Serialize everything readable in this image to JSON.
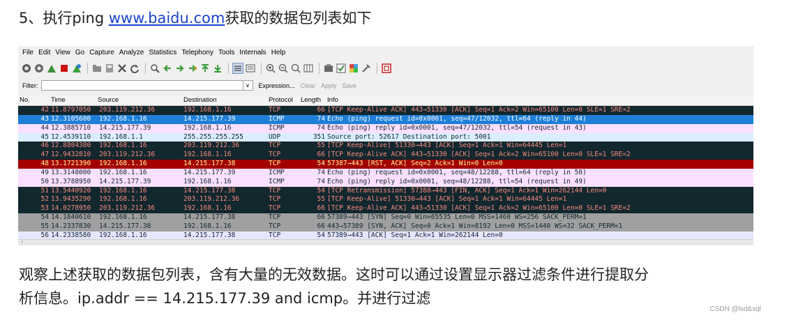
{
  "heading": {
    "prefix": "5、执行ping ",
    "link": "www.baidu.com",
    "suffix": "获取的数据包列表如下"
  },
  "menu": [
    "File",
    "Edit",
    "View",
    "Go",
    "Capture",
    "Analyze",
    "Statistics",
    "Telephony",
    "Tools",
    "Internals",
    "Help"
  ],
  "filter": {
    "label": "Filter:",
    "value": "",
    "expression": "Expression...",
    "clear": "Clear",
    "apply": "Apply",
    "save": "Save"
  },
  "columns": {
    "no": "No.",
    "time": "Time",
    "source": "Source",
    "destination": "Destination",
    "protocol": "Protocol",
    "length": "Length",
    "info": "Info"
  },
  "row_colors": {
    "dark": {
      "bg": "#12272e",
      "fg": "#f78b7e"
    },
    "selected": {
      "bg": "#1e7fd8",
      "fg": "#ffffff"
    },
    "icmp": {
      "bg": "#fce0ff",
      "fg": "#12272e"
    },
    "udp": {
      "bg": "#daeeff",
      "fg": "#12272e"
    },
    "rst": {
      "bg": "#a40000",
      "fg": "#fffc9c"
    },
    "gray": {
      "bg": "#a0a0a0",
      "fg": "#12272e"
    },
    "light": {
      "bg": "#e7e6ff",
      "fg": "#12272e"
    }
  },
  "packets": [
    {
      "no": "42",
      "time": "11.8797050",
      "src": "203.119.212.36",
      "dst": "192.168.1.16",
      "proto": "TCP",
      "len": "66",
      "info": "[TCP Keep-Alive ACK] 443→51330 [ACK] Seq=1 Ack=2 Win=65100 Len=0 SLE=1 SRE=2",
      "style": "dark"
    },
    {
      "no": "43",
      "time": "12.3105600",
      "src": "192.168.1.16",
      "dst": "14.215.177.39",
      "proto": "ICMP",
      "len": "74",
      "info": "Echo (ping) request  id=0x0001, seq=47/12032, ttl=64 (reply in 44)",
      "style": "selected"
    },
    {
      "no": "44",
      "time": "12.3885710",
      "src": "14.215.177.39",
      "dst": "192.168.1.16",
      "proto": "ICMP",
      "len": "74",
      "info": "Echo (ping) reply    id=0x0001, seq=47/12032, ttl=54 (request in 43)",
      "style": "icmp"
    },
    {
      "no": "45",
      "time": "12.4539110",
      "src": "192.168.1.1",
      "dst": "255.255.255.255",
      "proto": "UDP",
      "len": "351",
      "info": "Source port: 52617  Destination port: 5001",
      "style": "udp"
    },
    {
      "no": "46",
      "time": "12.8804380",
      "src": "192.168.1.16",
      "dst": "203.119.212.36",
      "proto": "TCP",
      "len": "55",
      "info": "[TCP Keep-Alive] 51330→443 [ACK] Seq=1 Ack=1 Win=64445 Len=1",
      "style": "dark"
    },
    {
      "no": "47",
      "time": "12.9432810",
      "src": "203.119.212.36",
      "dst": "192.168.1.16",
      "proto": "TCP",
      "len": "66",
      "info": "[TCP Keep-Alive ACK] 443→51330 [ACK] Seq=1 Ack=2 Win=65100 Len=0 SLE=1 SRE=2",
      "style": "dark"
    },
    {
      "no": "48",
      "time": "13.1721390",
      "src": "192.168.1.16",
      "dst": "14.215.177.38",
      "proto": "TCP",
      "len": "54",
      "info": "57387→443 [RST, ACK] Seq=2 Ack=1 Win=0 Len=0",
      "style": "rst"
    },
    {
      "no": "49",
      "time": "13.3148000",
      "src": "192.168.1.16",
      "dst": "14.215.177.39",
      "proto": "ICMP",
      "len": "74",
      "info": "Echo (ping) request  id=0x0001, seq=48/12288, ttl=64 (reply in 50)",
      "style": "icmp"
    },
    {
      "no": "50",
      "time": "13.3788950",
      "src": "14.215.177.39",
      "dst": "192.168.1.16",
      "proto": "ICMP",
      "len": "74",
      "info": "Echo (ping) reply    id=0x0001, seq=48/12288, ttl=54 (request in 49)",
      "style": "icmp"
    },
    {
      "no": "51",
      "time": "13.5440920",
      "src": "192.168.1.16",
      "dst": "14.215.177.38",
      "proto": "TCP",
      "len": "54",
      "info": "[TCP Retransmission] 57388→443 [FIN, ACK] Seq=1 Ack=1 Win=262144 Len=0",
      "style": "dark"
    },
    {
      "no": "52",
      "time": "13.9435290",
      "src": "192.168.1.16",
      "dst": "203.119.212.36",
      "proto": "TCP",
      "len": "55",
      "info": "[TCP Keep-Alive] 51330→443 [ACK] Seq=1 Ack=1 Win=64445 Len=1",
      "style": "dark"
    },
    {
      "no": "53",
      "time": "14.0278950",
      "src": "203.119.212.36",
      "dst": "192.168.1.16",
      "proto": "TCP",
      "len": "66",
      "info": "[TCP Keep-Alive ACK] 443→51330 [ACK] Seq=1 Ack=2 Win=65100 Len=0 SLE=1 SRE=2",
      "style": "dark"
    },
    {
      "no": "54",
      "time": "14.1840610",
      "src": "192.168.1.16",
      "dst": "14.215.177.38",
      "proto": "TCP",
      "len": "66",
      "info": "57389→443 [SYN] Seq=0 Win=65535 Len=0 MSS=1460 WS=256 SACK_PERM=1",
      "style": "gray"
    },
    {
      "no": "55",
      "time": "14.2337830",
      "src": "14.215.177.38",
      "dst": "192.168.1.16",
      "proto": "TCP",
      "len": "66",
      "info": "443→57389 [SYN, ACK] Seq=0 Ack=1 Win=8192 Len=0 MSS=1440 WS=32 SACK_PERM=1",
      "style": "gray"
    },
    {
      "no": "56",
      "time": "14.2338580",
      "src": "192.168.1.16",
      "dst": "14.215.177.38",
      "proto": "TCP",
      "len": "54",
      "info": "57389→443 [ACK] Seq=1 Ack=1 Win=262144 Len=0",
      "style": "light"
    }
  ],
  "paragraph": {
    "line1": "观察上述获取的数据包列表，含有大量的无效数据。这时可以通过设置显示器过滤条件进行提取分",
    "line2": "析信息。ip.addr == 14.215.177.39 and icmp。并进行过滤"
  },
  "watermark": "CSDN @lsd&xql"
}
